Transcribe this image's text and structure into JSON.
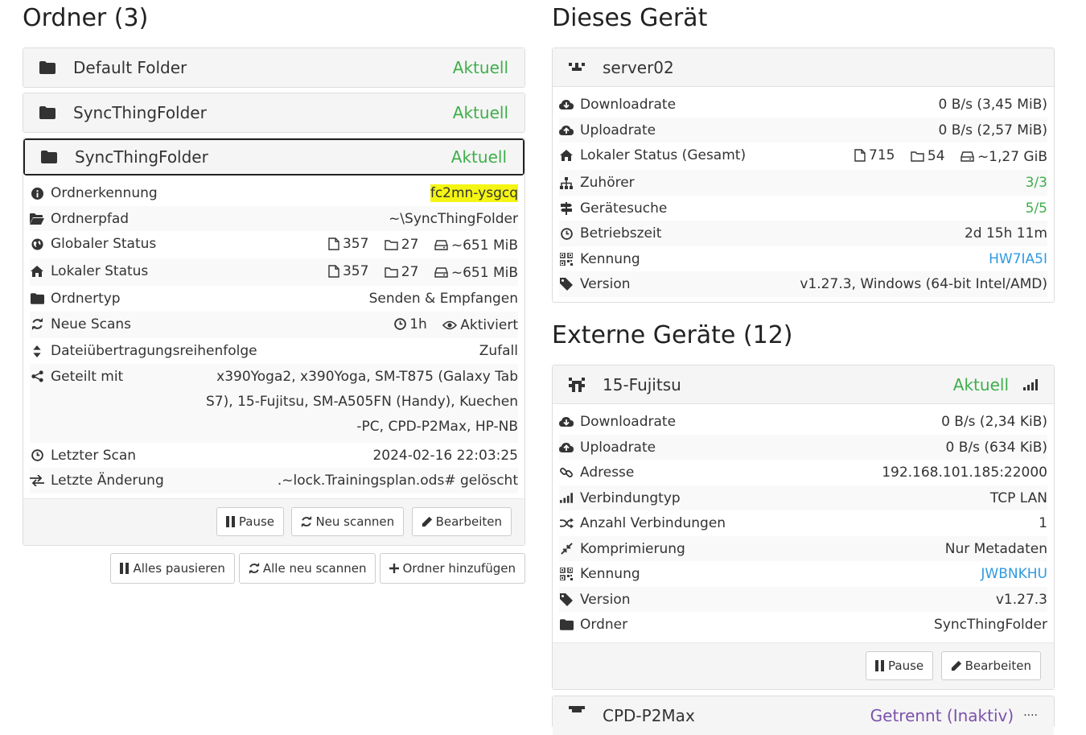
{
  "left": {
    "heading": "Ordner (3)",
    "folders": [
      {
        "name": "Default Folder",
        "status": "Aktuell"
      },
      {
        "name": "SyncThingFolder",
        "status": "Aktuell"
      },
      {
        "name": "SyncThingFolder",
        "status": "Aktuell"
      }
    ],
    "details": {
      "folder_id_label": "Ordnerkennung",
      "folder_id_value": "fc2mn-ysgcq",
      "folder_path_label": "Ordnerpfad",
      "folder_path_value": "~\\SyncThingFolder",
      "global_label": "Globaler Status",
      "global_files": "357",
      "global_dirs": "27",
      "global_size": "~651 MiB",
      "local_label": "Lokaler Status",
      "local_files": "357",
      "local_dirs": "27",
      "local_size": "~651 MiB",
      "type_label": "Ordnertyp",
      "type_value": "Senden & Empfangen",
      "rescan_label": "Neue Scans",
      "rescan_interval": "1h",
      "rescan_watch": "Aktiviert",
      "order_label": "Dateiübertragungsreihenfolge",
      "order_value": "Zufall",
      "shared_label": "Geteilt mit",
      "shared_value": "x390Yoga2, x390Yoga, SM-T875 (Galaxy Tab S7), 15-Fujitsu, SM-A505FN (Handy), Kuechen-PC, CPD-P2Max, HP-NB",
      "lastscan_label": "Letzter Scan",
      "lastscan_value": "2024-02-16 22:03:25",
      "lastchange_label": "Letzte Änderung",
      "lastchange_value": ".~lock.Trainingsplan.ods# gelöscht"
    },
    "buttons": {
      "pause": "Pause",
      "rescan": "Neu scannen",
      "edit": "Bearbeiten"
    },
    "global_buttons": {
      "pause_all": "Alles pausieren",
      "rescan_all": "Alle neu scannen",
      "add_folder": "Ordner hinzufügen"
    }
  },
  "right": {
    "heading": "Dieses Gerät",
    "device_name": "server02",
    "rows": {
      "download_label": "Downloadrate",
      "download_value": "0 B/s (3,45 MiB)",
      "upload_label": "Uploadrate",
      "upload_value": "0 B/s (2,57 MiB)",
      "local_label": "Lokaler Status (Gesamt)",
      "local_files": "715",
      "local_dirs": "54",
      "local_size": "~1,27 GiB",
      "listeners_label": "Zuhörer",
      "listeners_value": "3/3",
      "discovery_label": "Gerätesuche",
      "discovery_value": "5/5",
      "uptime_label": "Betriebszeit",
      "uptime_value": "2d 15h 11m",
      "id_label": "Kennung",
      "id_value": "HW7IA5I",
      "version_label": "Version",
      "version_value": "v1.27.3, Windows (64-bit Intel/AMD)"
    },
    "remote_heading": "Externe Geräte (12)",
    "remote": {
      "name": "15-Fujitsu",
      "status": "Aktuell",
      "download_label": "Downloadrate",
      "download_value": "0 B/s (2,34 KiB)",
      "upload_label": "Uploadrate",
      "upload_value": "0 B/s (634 KiB)",
      "address_label": "Adresse",
      "address_value": "192.168.101.185:22000",
      "conntype_label": "Verbindungtyp",
      "conntype_value": "TCP LAN",
      "conncount_label": "Anzahl Verbindungen",
      "conncount_value": "1",
      "compress_label": "Komprimierung",
      "compress_value": "Nur Metadaten",
      "id_label": "Kennung",
      "id_value": "JWBNKHU",
      "version_label": "Version",
      "version_value": "v1.27.3",
      "folders_label": "Ordner",
      "folders_value": "SyncThingFolder",
      "pause": "Pause",
      "edit": "Bearbeiten"
    },
    "next_remote": {
      "name": "CPD-P2Max",
      "status": "Getrennt (Inaktiv)"
    }
  },
  "colors": {
    "green": "#3fae4a",
    "blue": "#2f9ae0",
    "purple": "#7b52ab",
    "highlight": "#f5f513"
  }
}
